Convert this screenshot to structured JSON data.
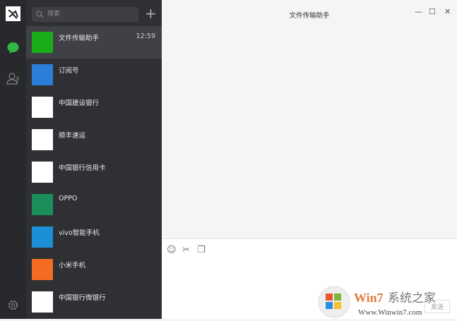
{
  "sidebar": {
    "icons": [
      "avatar",
      "chat-icon",
      "contacts-icon",
      "settings-icon"
    ]
  },
  "search": {
    "placeholder": "搜索"
  },
  "chats": [
    {
      "name": "文件传输助手",
      "time": "12:59",
      "color": "#1aad19",
      "selected": true
    },
    {
      "name": "订阅号",
      "color": "#2c7fd8"
    },
    {
      "name": "中国建设银行",
      "color": "#ffffff"
    },
    {
      "name": "顺丰速运",
      "color": "#ffffff"
    },
    {
      "name": "中国银行信用卡",
      "color": "#ffffff"
    },
    {
      "name": "OPPO",
      "color": "#1a8f5a"
    },
    {
      "name": "vivo智能手机",
      "color": "#1c8fd6"
    },
    {
      "name": "小米手机",
      "color": "#f36c21"
    },
    {
      "name": "中国银行微银行",
      "color": "#ffffff"
    }
  ],
  "chat": {
    "title": "文件传输助手",
    "send_label": "发送"
  },
  "watermark": {
    "text": "Win7系统之家",
    "url_text": "Www.Winwin7.com"
  }
}
